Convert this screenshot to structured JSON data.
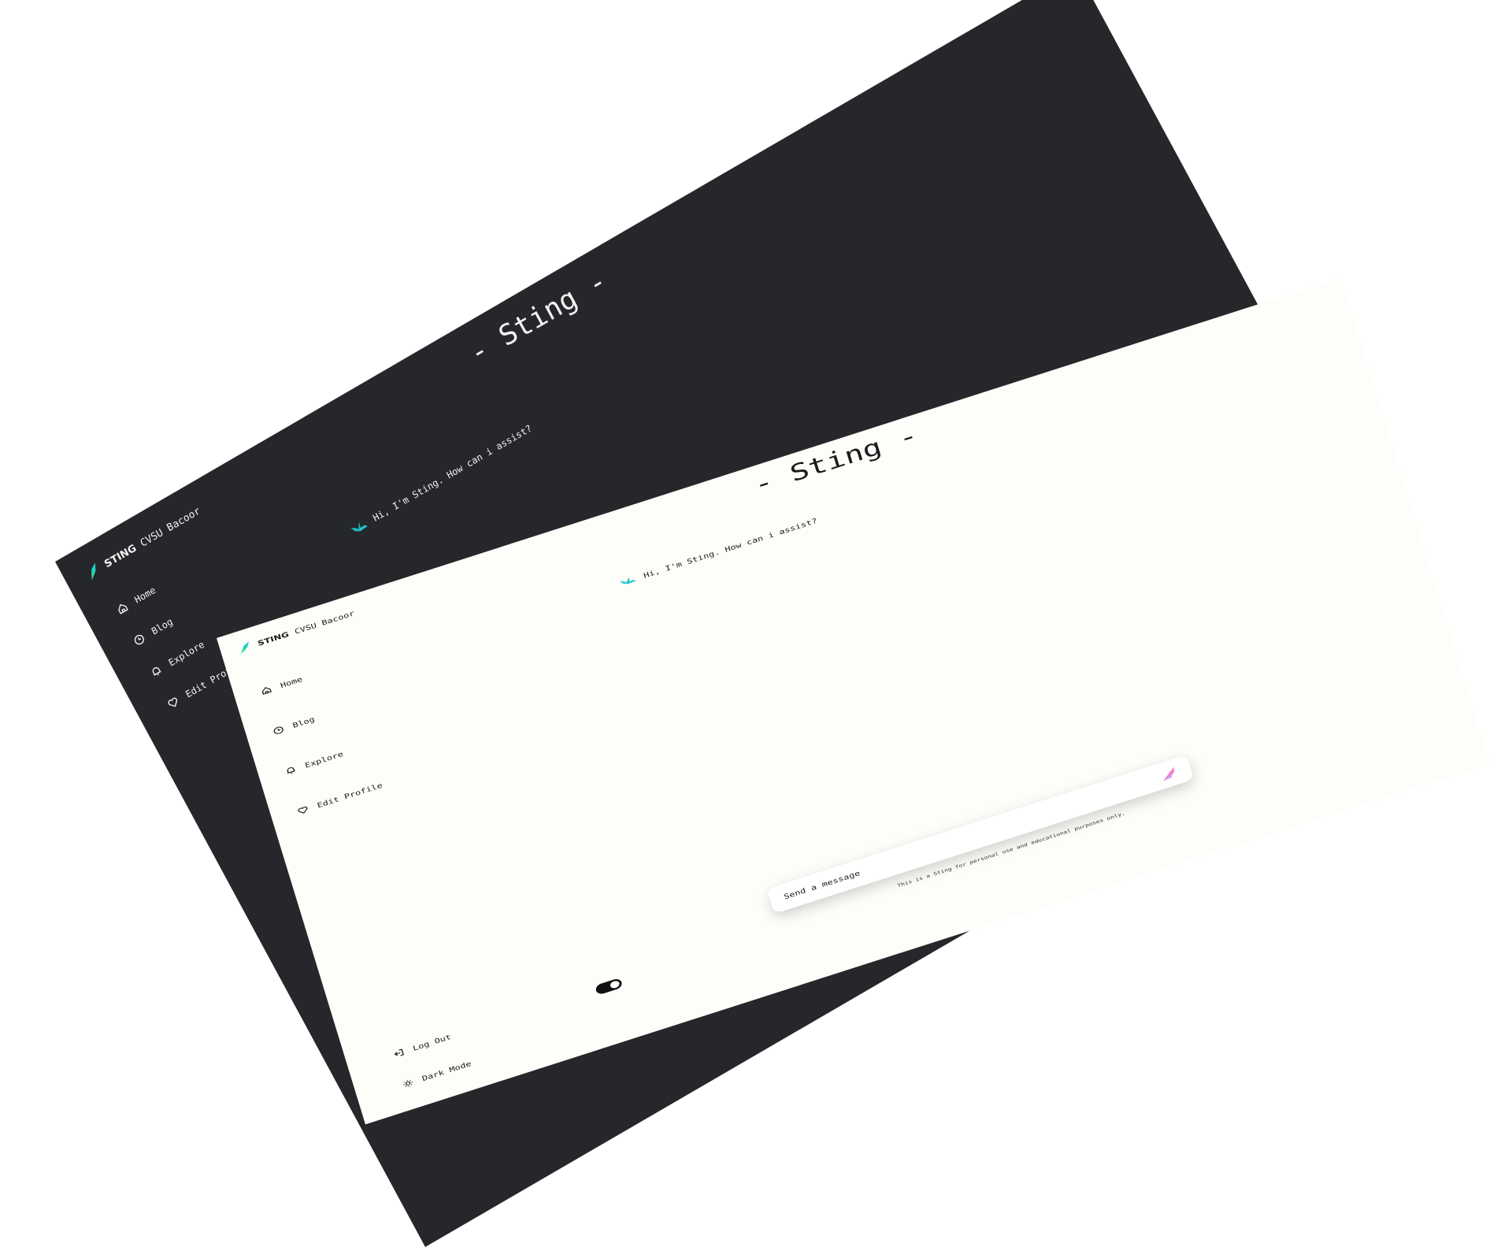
{
  "brand": {
    "name": "STING",
    "org": "CVSU Bacoor"
  },
  "nav": [
    {
      "label": "Home",
      "icon": "home-icon"
    },
    {
      "label": "Blog",
      "icon": "clock-icon"
    },
    {
      "label": "Explore",
      "icon": "bell-icon"
    },
    {
      "label": "Edit Profile",
      "icon": "heart-icon"
    }
  ],
  "main": {
    "title": "- Sting -",
    "greeting": "Hi, I'm Sting. How can i assist?"
  },
  "composer": {
    "placeholder": "Send a message",
    "disclaimer": "This is a Sting for personal use and educational purposes only."
  },
  "bottom": {
    "logout_label": "Log Out",
    "dark_mode_label": "Dark Mode",
    "dark_mode_on": true
  },
  "colors": {
    "dark_bg": "#26272a",
    "light_bg": "#fdfdf9",
    "accent": "#1fd1c1"
  }
}
